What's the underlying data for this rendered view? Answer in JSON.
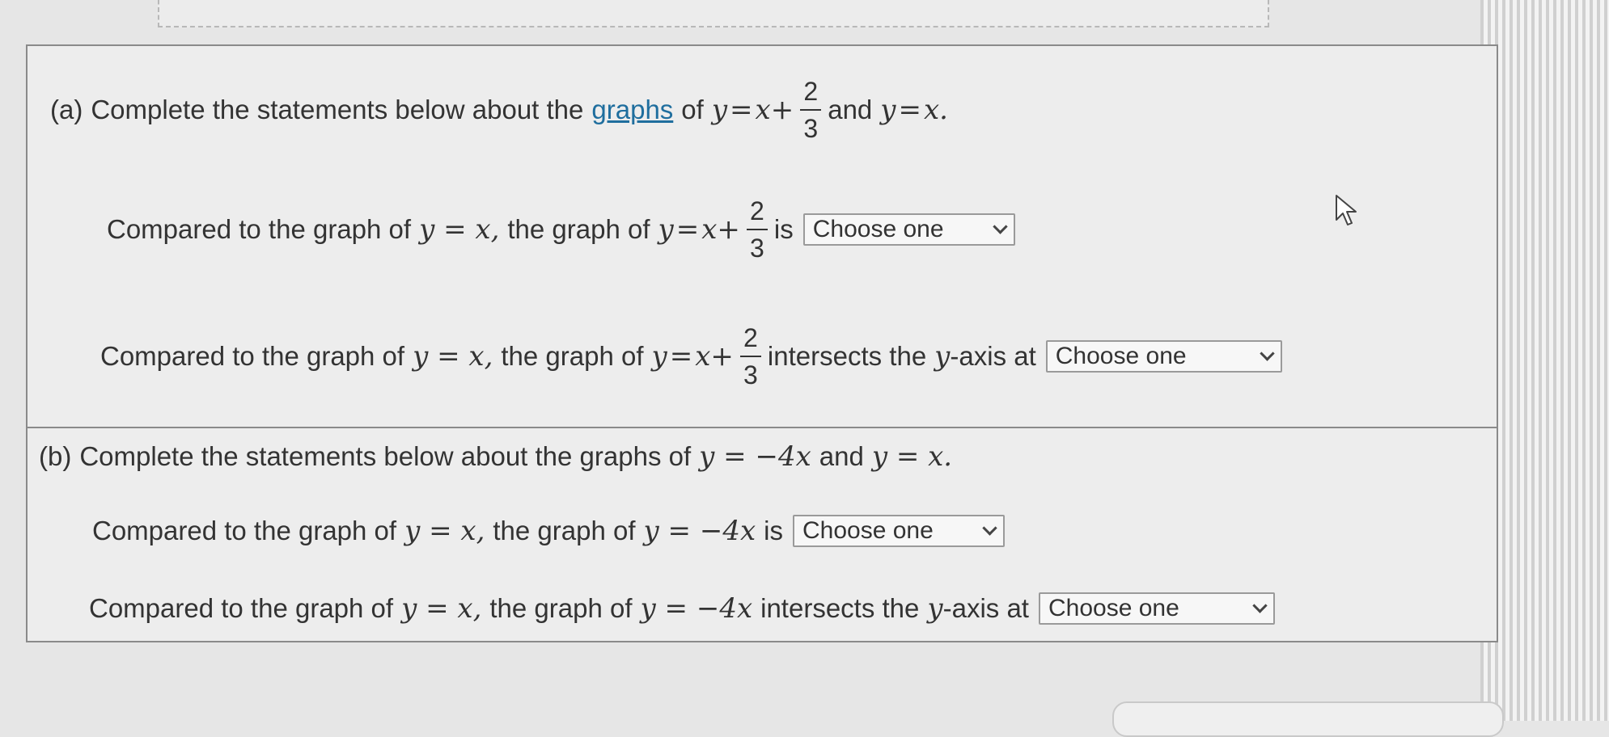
{
  "part_a": {
    "intro_label": "(a)",
    "intro_text": "Complete the statements below about the",
    "graphs_link": "graphs",
    "of_text": "of",
    "and_text": "and",
    "eq1": {
      "lhs": "y",
      "rel": "=",
      "rhs": "x+",
      "num": "2",
      "den": "3"
    },
    "eq2": {
      "lhs": "y",
      "rel": "=",
      "rhs": "x."
    },
    "statement1": {
      "lead": "Compared to the graph of",
      "base_eq": "y = x,",
      "mid": "the graph of",
      "tail": "is",
      "select_value": "Choose one"
    },
    "statement2": {
      "lead": "Compared to the graph of",
      "base_eq": "y = x,",
      "mid": "the graph of",
      "tail_pre": "intersects the",
      "axis_var": "y",
      "tail_post": "-axis at",
      "select_value": "Choose one"
    }
  },
  "part_b": {
    "intro_label": "(b)",
    "intro_text": "Complete the statements below about the graphs of",
    "eq1": "y = −4x",
    "and_text": "and",
    "eq2": "y = x.",
    "statement1": {
      "lead": "Compared to the graph of",
      "base_eq": "y = x,",
      "mid": "the graph of",
      "eq": "y = −4x",
      "tail": "is",
      "select_value": "Choose one"
    },
    "statement2": {
      "lead": "Compared to the graph of",
      "base_eq": "y = x,",
      "mid": "the graph of",
      "eq": "y = −4x",
      "tail_pre": "intersects the",
      "axis_var": "y",
      "tail_post": "-axis at",
      "select_value": "Choose one"
    }
  },
  "colors": {
    "link": "#1f6e9e",
    "panel": "#ededed",
    "border": "#8a8a8a"
  }
}
